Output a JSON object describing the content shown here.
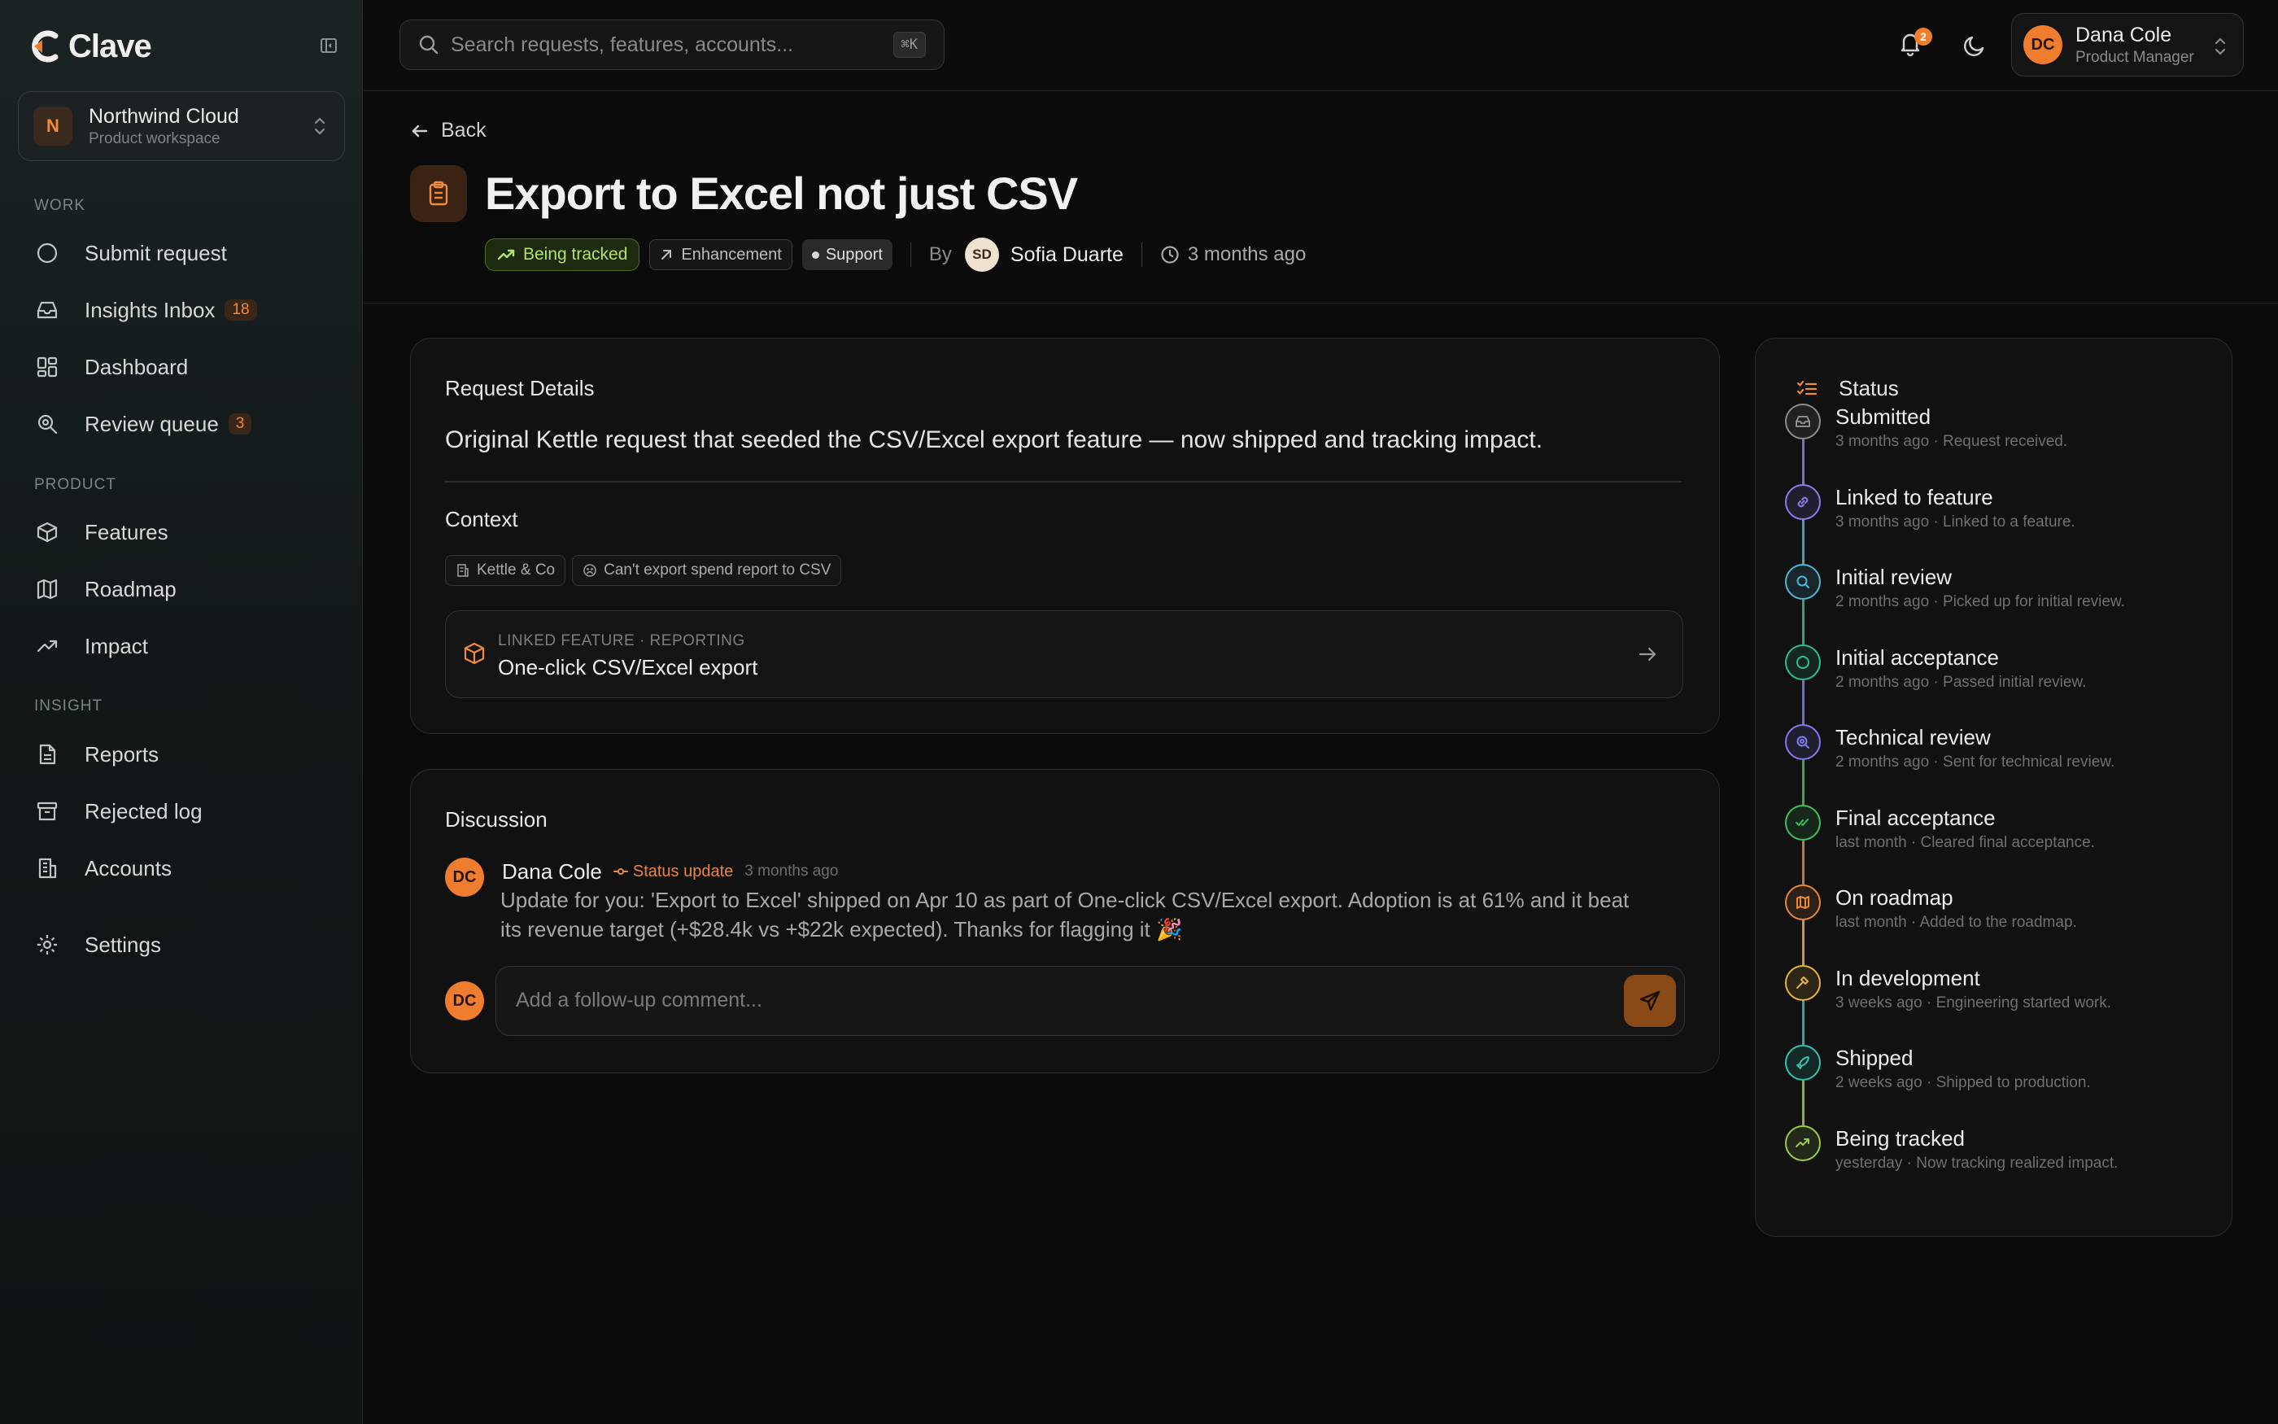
{
  "brand": {
    "name": "Clave"
  },
  "workspace": {
    "initial": "N",
    "name": "Northwind Cloud",
    "subtitle": "Product workspace"
  },
  "nav": {
    "sections": [
      {
        "label": "WORK"
      },
      {
        "label": "PRODUCT"
      },
      {
        "label": "INSIGHT"
      }
    ],
    "items": [
      {
        "label": "Submit request",
        "icon": "circle-icon"
      },
      {
        "label": "Insights Inbox",
        "badge": "18",
        "icon": "inbox-icon"
      },
      {
        "label": "Dashboard",
        "icon": "dashboard-icon"
      },
      {
        "label": "Review queue",
        "badge": "3",
        "icon": "review-search-icon"
      },
      {
        "label": "Features",
        "icon": "box-icon"
      },
      {
        "label": "Roadmap",
        "icon": "map-icon"
      },
      {
        "label": "Impact",
        "icon": "trending-up-icon"
      },
      {
        "label": "Reports",
        "icon": "document-icon"
      },
      {
        "label": "Rejected log",
        "icon": "archive-icon"
      },
      {
        "label": "Accounts",
        "icon": "building-icon"
      },
      {
        "label": "Settings",
        "icon": "gear-icon"
      }
    ]
  },
  "topbar": {
    "search_placeholder": "Search requests, features, accounts...",
    "shortcut": "⌘K",
    "notifications_count": "2",
    "user": {
      "initials": "DC",
      "name": "Dana Cole",
      "role": "Product Manager"
    }
  },
  "request": {
    "back_label": "Back",
    "title": "Export to Excel not just CSV",
    "status_pill": "Being tracked",
    "type_tag": "Enhancement",
    "source_tag": "Support",
    "by_label": "By",
    "author_initials": "SD",
    "author": "Sofia Duarte",
    "created": "3 months ago"
  },
  "details": {
    "title": "Request Details",
    "text": "Original Kettle request that seeded the CSV/Excel export feature — now shipped and tracking impact.",
    "context_title": "Context",
    "context_tags": [
      "Kettle & Co",
      "Can't export spend report to CSV"
    ],
    "linked_feature": {
      "eyebrow": "LINKED FEATURE · REPORTING",
      "name": "One-click CSV/Excel export"
    }
  },
  "discussion": {
    "title": "Discussion",
    "comment": {
      "initials": "DC",
      "author": "Dana Cole",
      "status_label": "Status update",
      "time": "3 months ago",
      "body": "Update for you: 'Export to Excel' shipped on Apr 10 as part of One-click CSV/Excel export. Adoption is at 61% and it beat its revenue target (+$28.4k vs +$22k expected). Thanks for flagging it 🎉"
    },
    "composer": {
      "initials": "DC",
      "placeholder": "Add a follow-up comment..."
    }
  },
  "status": {
    "title": "Status",
    "steps": [
      {
        "label": "Submitted",
        "sub": "3 months ago · Request received.",
        "color": "#8a8f86",
        "icon": "inbox-icon"
      },
      {
        "label": "Linked to feature",
        "sub": "3 months ago · Linked to a feature.",
        "color": "#8b7cf0",
        "icon": "link-icon"
      },
      {
        "label": "Initial review",
        "sub": "2 months ago · Picked up for initial review.",
        "color": "#4fb6d6",
        "icon": "search-icon"
      },
      {
        "label": "Initial acceptance",
        "sub": "2 months ago · Passed initial review.",
        "color": "#2fbf8a",
        "icon": "circle-icon"
      },
      {
        "label": "Technical review",
        "sub": "2 months ago · Sent for technical review.",
        "color": "#7f7cf0",
        "icon": "review-search-icon"
      },
      {
        "label": "Final acceptance",
        "sub": "last month · Cleared final acceptance.",
        "color": "#3fbf5e",
        "icon": "double-check-icon"
      },
      {
        "label": "On roadmap",
        "sub": "last month · Added to the roadmap.",
        "color": "#e8893a",
        "icon": "map-icon"
      },
      {
        "label": "In development",
        "sub": "3 weeks ago · Engineering started work.",
        "color": "#e6b43a",
        "icon": "hammer-icon"
      },
      {
        "label": "Shipped",
        "sub": "2 weeks ago · Shipped to production.",
        "color": "#2fc4b0",
        "icon": "rocket-icon"
      },
      {
        "label": "Being tracked",
        "sub": "yesterday · Now tracking realized impact.",
        "color": "#9ccc4a",
        "icon": "trending-up-icon"
      }
    ]
  },
  "colors": {
    "accent": "#f07d2e",
    "background": "#0b0b0b",
    "tracked": "#b4e06c"
  }
}
